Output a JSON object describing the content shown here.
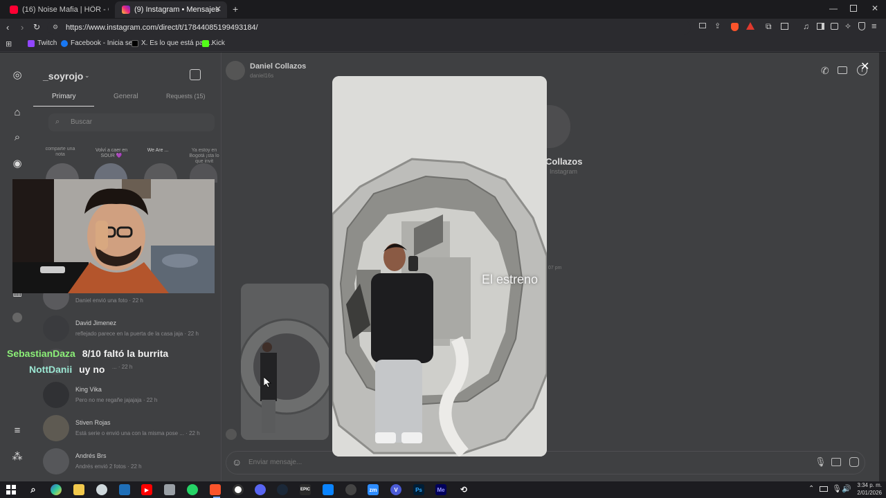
{
  "browser": {
    "tabs": [
      {
        "title": "(16) Noise Mafia | HÖR - October 12",
        "icon": "youtube-icon",
        "active": false
      },
      {
        "title": "(9) Instagram • Mensajes",
        "icon": "instagram-icon",
        "active": true
      }
    ],
    "new_tab": "+",
    "url": "https://www.instagram.com/direct/t/17844085199493184/",
    "bookmarks": [
      {
        "label": "Twitch",
        "icon": "twitch-icon",
        "color": "#9146ff"
      },
      {
        "label": "Facebook - Inicia se...",
        "icon": "facebook-icon",
        "color": "#1877f2"
      },
      {
        "label": "X. Es lo que está pas...",
        "icon": "x-icon",
        "color": "#000000"
      },
      {
        "label": "Kick",
        "icon": "kick-icon",
        "color": "#53fc18"
      }
    ]
  },
  "instagram": {
    "username": "_soyrojo",
    "tabs": {
      "primary": "Primary",
      "general": "General",
      "requests": "Requests (15)"
    },
    "search_placeholder": "Buscar",
    "notes": [
      "comparte una nota",
      "Volví a caer en SOUR 💜",
      "We Are ...",
      "Ya estoy en Bogotá ¡sta lo que invit"
    ],
    "conversations": [
      {
        "name": "",
        "preview": "Daniel envió una foto · 22 h"
      },
      {
        "name": "David Jimenez",
        "preview": "reflejado parece en la puerta de la casa jaja · 22 h"
      },
      {
        "name": "",
        "preview": "... · 22 h"
      },
      {
        "name": "King Vika",
        "preview": "Pero no me regañe jajajaja · 22 h"
      },
      {
        "name": "Stiven Rojas",
        "preview": "Está serie o envió una con la misma pose ... · 22 h"
      },
      {
        "name": "Andrés Brs",
        "preview": "Andrés envió 2 fotos · 22 h"
      }
    ],
    "chat": {
      "contact_name": "Daniel Collazos",
      "contact_handle": "daniel16s",
      "profile_name": "Collazos",
      "profile_sub": "Instagram",
      "timestamp": "07 pm",
      "message_placeholder": "Enviar mensaje..."
    },
    "viewer": {
      "overlay_text": "El estreno",
      "close": "✕"
    }
  },
  "stream_chat": [
    {
      "user": "SebastianDaza",
      "message": "8/10 faltó la burrita",
      "color": "#8cf078"
    },
    {
      "user": "NottDanii",
      "message": "uy no",
      "color": "#9be6d2"
    }
  ],
  "taskbar": {
    "time": "3:34 p. m.",
    "date": "2/01/2026",
    "apps": [
      "start-icon",
      "search-icon",
      "copilot-icon",
      "explorer-icon",
      "edge-icon",
      "store-icon",
      "youtube-icon",
      "app-icon",
      "whatsapp-icon",
      "brave-icon",
      "obs-icon",
      "discord-icon",
      "steam-icon",
      "epic-icon",
      "vscode-icon",
      "chrome-icon",
      "zoom-icon",
      "v-icon",
      "photoshop-icon",
      "media-encoder-icon",
      "app2-icon"
    ],
    "app_labels": {
      "epic": "EPIC",
      "zoom": "zm",
      "v": "V",
      "ps": "Ps",
      "me": "Me"
    }
  },
  "colors": {
    "accent": "#0095f6",
    "page_bg": "#3f4042"
  }
}
